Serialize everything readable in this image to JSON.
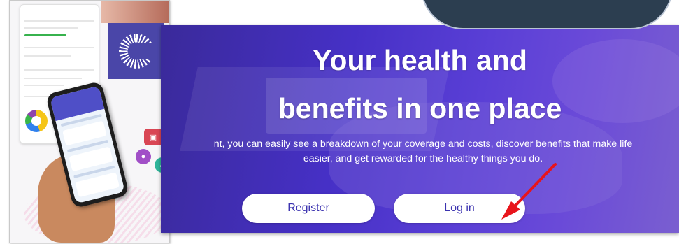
{
  "hero": {
    "title_line1": "Your health and",
    "title_line2": "benefits in one place",
    "body_line1": "nt, you can easily see a breakdown of your coverage and costs, discover benefits that make life",
    "body_line2": "easier, and get rewarded for the healthy things you do.",
    "register_label": "Register",
    "login_label": "Log in"
  },
  "colors": {
    "hero_background": "#4630c6",
    "button_text": "#3c33b0",
    "annotation_arrow": "#e8141b",
    "top_card": "#2c3e50"
  },
  "icons": {
    "logo": "concentric-ring-logo-icon",
    "badge_1": "monitor-icon",
    "badge_2": "person-icon",
    "badge_3": "activity-icon"
  }
}
